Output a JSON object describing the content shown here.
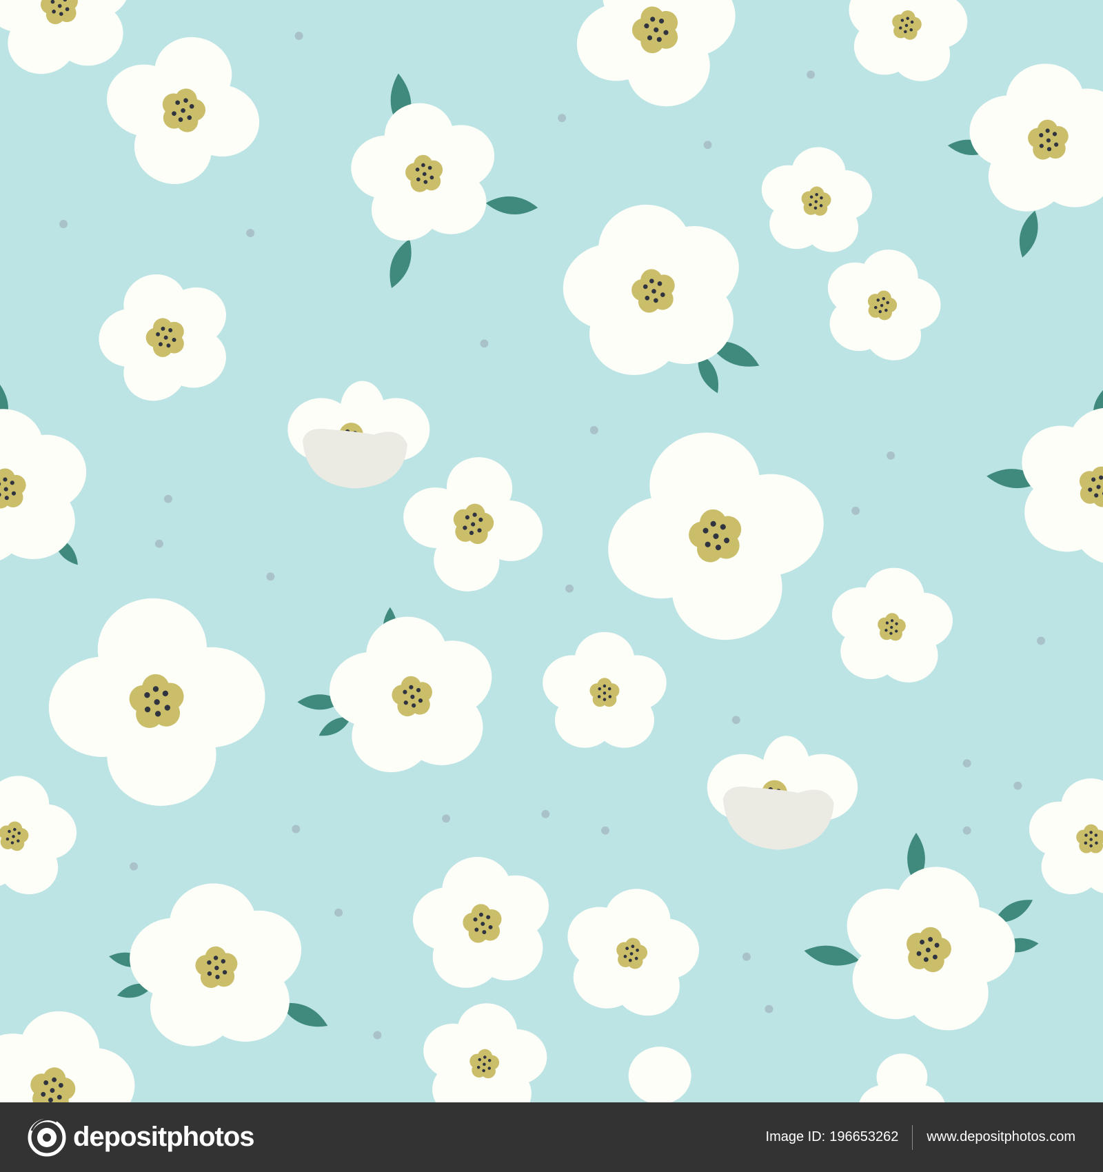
{
  "colors": {
    "sky": "#bde4e4",
    "dot": "#a9c2c9",
    "petal": "#fefef9",
    "petal_shade": "#ebebe3",
    "center": "#cbbe6a",
    "seed": "#2f3440",
    "leaf": "#3f8a7c",
    "footer_bg": "#333333",
    "footer_text": "#ffffff",
    "divider": "#8a8a8a"
  },
  "icons": {
    "logo": "camera-aperture-icon"
  },
  "footer": {
    "brand": "depositphotos",
    "image_id_label": "Image ID:",
    "image_id": "196653262",
    "website": "www.depositphotos.com"
  }
}
